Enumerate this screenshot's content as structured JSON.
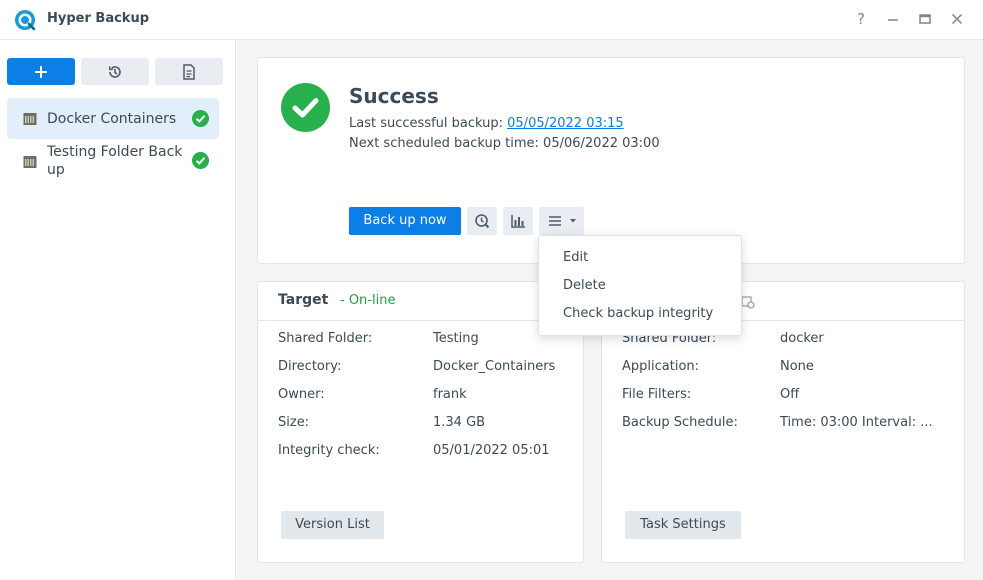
{
  "window": {
    "title": "Hyper Backup",
    "help_glyph": "?"
  },
  "sidebar": {
    "tasks": [
      {
        "label": "Docker Containers",
        "status": "success"
      },
      {
        "label": "Testing Folder Back up",
        "status": "success"
      }
    ]
  },
  "status": {
    "title": "Success",
    "last_label": "Last successful backup:",
    "last_value": "05/05/2022 03:15",
    "next_text": "Next scheduled backup time: 05/06/2022 03:00",
    "backup_now": "Back up now"
  },
  "menu": {
    "items": [
      "Edit",
      "Delete",
      "Check backup integrity"
    ]
  },
  "target": {
    "title": "Target",
    "status": "- On-line",
    "rows": [
      {
        "key": "Shared Folder:",
        "value": "Testing"
      },
      {
        "key": "Directory:",
        "value": "Docker_Containers"
      },
      {
        "key": "Owner:",
        "value": "frank"
      },
      {
        "key": "Size:",
        "value": "1.34 GB"
      },
      {
        "key": "Integrity check:",
        "value": "05/01/2022 05:01"
      }
    ],
    "button": "Version List"
  },
  "settings": {
    "rows": [
      {
        "key": "Shared Folder:",
        "value": "docker"
      },
      {
        "key": "Application:",
        "value": "None"
      },
      {
        "key": "File Filters:",
        "value": "Off"
      },
      {
        "key": "Backup Schedule:",
        "value": "Time: 03:00 Interval: ..."
      }
    ],
    "button": "Task Settings"
  },
  "colors": {
    "accent": "#0b7fe5",
    "success": "#27b04c",
    "online": "#27a03f"
  }
}
